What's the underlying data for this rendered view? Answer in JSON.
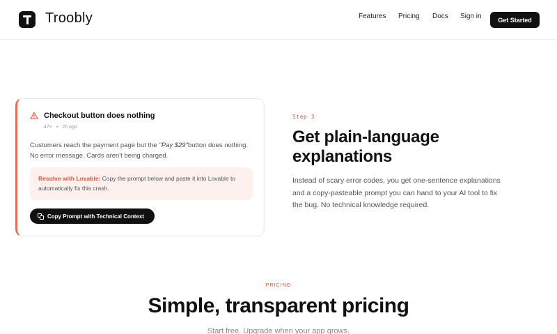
{
  "header": {
    "logo_text": "Troobly",
    "nav": [
      "Features",
      "Pricing",
      "Docs",
      "Sign in"
    ],
    "cta": "Get Started"
  },
  "card": {
    "icon": "warning-triangle-icon",
    "title": "Checkout button does nothing",
    "count": "47×",
    "time": "2h ago",
    "desc_pre": "Customers reach the payment page but the",
    "desc_quote": "\"Pay $29\"",
    "desc_post": "button does nothing. No error message. Cards aren't being charged.",
    "resolve_lead": "Resolve with Lovable:",
    "resolve_text": "Copy the prompt below and paste it into Lovable to automatically fix this crash.",
    "copy_button": "Copy Prompt with Technical Context"
  },
  "step": {
    "label": "Step 3",
    "title": "Get plain-language explanations",
    "body": "Instead of scary error codes, you get one-sentence explanations and a copy-pasteable prompt you can hand to your AI tool to fix the bug. No technical knowledge required."
  },
  "pricing": {
    "eyebrow": "PRICING",
    "title": "Simple, transparent pricing",
    "subtitle": "Start free. Upgrade when your app grows."
  },
  "colors": {
    "accent": "#e4553a",
    "dark": "#111111",
    "resolve_bg": "#fdf1ee"
  }
}
